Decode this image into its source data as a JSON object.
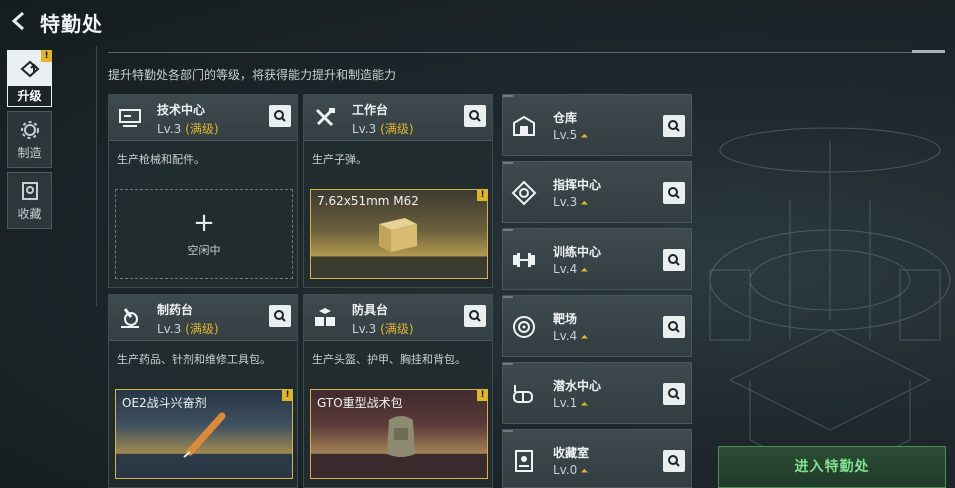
{
  "header": {
    "back_icon": "back-arrow-icon",
    "title": "特勤处"
  },
  "subtitle": "提升特勤处各部门的等级，将获得能力提升和制造能力",
  "nav": [
    {
      "label": "升级",
      "icon": "upgrade-icon",
      "active": true,
      "badge": "!"
    },
    {
      "label": "制造",
      "icon": "gear-icon",
      "active": false
    },
    {
      "label": "收藏",
      "icon": "collection-icon",
      "active": false
    }
  ],
  "cards": [
    {
      "name": "技术中心",
      "level": "Lv.3",
      "max": "(满级)",
      "desc": "生产枪械和配件。",
      "slot": {
        "type": "idle",
        "plus": "+",
        "label": "空闲中"
      }
    },
    {
      "name": "工作台",
      "level": "Lv.3",
      "max": "(满级)",
      "desc": "生产子弹。",
      "slot": {
        "type": "item",
        "name": "7.62x51mm M62",
        "badge": "!",
        "style": "gold"
      }
    },
    {
      "name": "制药台",
      "level": "Lv.3",
      "max": "(满级)",
      "desc": "生产药品、针剂和维修工具包。",
      "slot": {
        "type": "item",
        "name": "OE2战斗兴奋剂",
        "badge": "!",
        "style": "blue"
      }
    },
    {
      "name": "防具台",
      "level": "Lv.3",
      "max": "(满级)",
      "desc": "生产头盔、护甲、胸挂和背包。",
      "slot": {
        "type": "item",
        "name": "GTO重型战术包",
        "badge": "!",
        "style": "red"
      }
    }
  ],
  "departments": [
    {
      "name": "仓库",
      "level": "Lv.5",
      "icon": "warehouse-icon"
    },
    {
      "name": "指挥中心",
      "level": "Lv.3",
      "icon": "command-center-icon"
    },
    {
      "name": "训练中心",
      "level": "Lv.4",
      "icon": "dumbbell-icon"
    },
    {
      "name": "靶场",
      "level": "Lv.4",
      "icon": "target-icon"
    },
    {
      "name": "潜水中心",
      "level": "Lv.1",
      "icon": "diving-mask-icon"
    },
    {
      "name": "收藏室",
      "level": "Lv.0",
      "icon": "collection-room-icon"
    }
  ],
  "enter_button": "进入特勤处",
  "colors": {
    "accent": "#e0b52c",
    "enter": "#7fe08e"
  }
}
